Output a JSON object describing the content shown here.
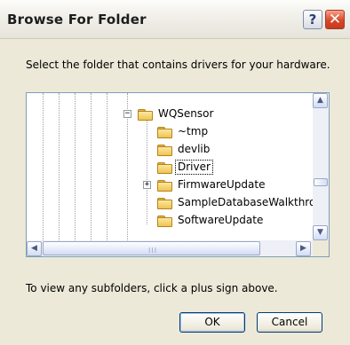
{
  "window": {
    "title": "Browse For Folder",
    "help_glyph": "?",
    "close_glyph": "✕"
  },
  "instruction": "Select the folder that contains drivers for your hardware.",
  "tree": {
    "items": [
      {
        "label": "WQSensor",
        "expander": "−",
        "selected": false
      },
      {
        "label": "~tmp",
        "expander": "",
        "selected": false
      },
      {
        "label": "devlib",
        "expander": "",
        "selected": false
      },
      {
        "label": "Driver",
        "expander": "",
        "selected": true
      },
      {
        "label": "FirmwareUpdate",
        "expander": "+",
        "selected": false
      },
      {
        "label": "SampleDatabaseWalkthrou",
        "expander": "",
        "selected": false
      },
      {
        "label": "SoftwareUpdate",
        "expander": "",
        "selected": false
      }
    ],
    "scroll_up": "▲",
    "scroll_down": "▼",
    "scroll_left": "◀",
    "scroll_right": "▶",
    "thumb_grip": "III"
  },
  "hint": "To view any subfolders, click a plus sign above.",
  "buttons": {
    "ok": "OK",
    "cancel": "Cancel"
  },
  "colors": {
    "dialog_bg": "#ece9d8",
    "tree_border": "#7f9db9",
    "folder": "#efc452",
    "close_button": "#d9482a"
  },
  "icons": [
    "help-icon",
    "close-icon",
    "folder-icon",
    "expand-icon",
    "collapse-icon",
    "arrow-up-icon",
    "arrow-down-icon",
    "arrow-left-icon",
    "arrow-right-icon"
  ]
}
